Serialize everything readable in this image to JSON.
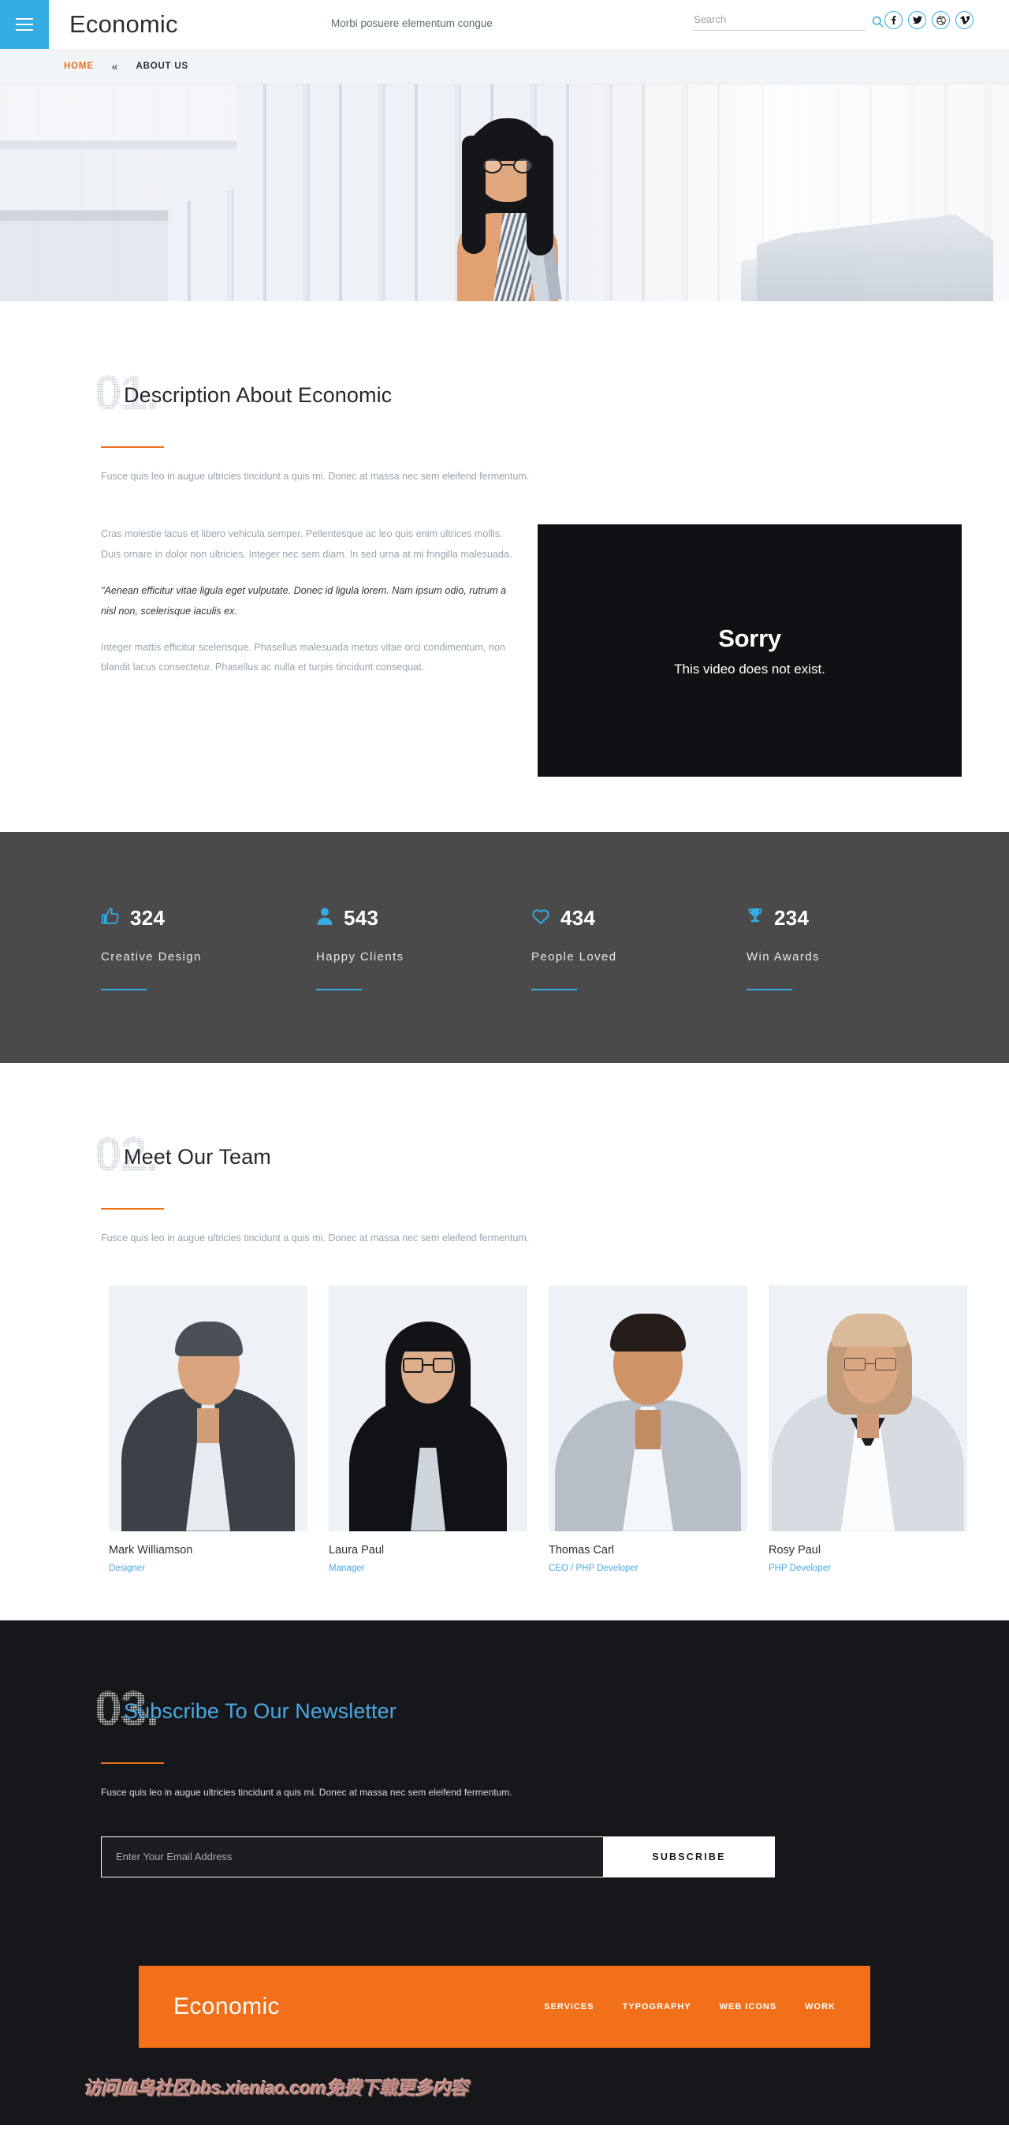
{
  "header": {
    "menu_icon": "hamburger-icon",
    "brand": "Economic",
    "tagline": "Morbi posuere elementum congue",
    "search": {
      "placeholder": "Search",
      "value": "",
      "icon": "search-icon"
    },
    "socials": [
      {
        "name": "facebook-icon",
        "glyph": "f"
      },
      {
        "name": "twitter-icon",
        "glyph": "t"
      },
      {
        "name": "dribbble-icon",
        "glyph": "d"
      },
      {
        "name": "vimeo-icon",
        "glyph": "v"
      }
    ]
  },
  "nav": {
    "items": [
      {
        "label": "HOME",
        "active": true
      },
      {
        "label": "ABOUT US",
        "active": false
      }
    ],
    "separator": "«"
  },
  "section01": {
    "number": "01.",
    "title": "Description About Economic",
    "lead": "Fusce quis leo in augue ultricies tincidunt a quis mi. Donec at massa nec sem eleifend fermentum.",
    "paragraphs": [
      "Cras molestie lacus et libero vehicula semper. Pellentesque ac leo quis enim ultrices mollis. Duis ornare in dolor non ultricies. Integer nec sem diam. In sed urna at mi fringilla malesuada.",
      "\"Aenean efficitur vitae ligula eget vulputate. Donec id ligula lorem. Nam ipsum odio, rutrum a nisl non, scelerisque iaculis ex.",
      "Integer mattis efficitur scelerisque. Phasellus malesuada metus vitae orci condimentum, non blandit lacus consectetur. Phasellus ac nulla et turpis tincidunt consequat."
    ],
    "video": {
      "title": "Sorry",
      "message": "This video does not exist."
    }
  },
  "stats": [
    {
      "icon": "thumbs-up-icon",
      "value": "324",
      "label": "Creative Design"
    },
    {
      "icon": "user-icon",
      "value": "543",
      "label": "Happy Clients"
    },
    {
      "icon": "heart-icon",
      "value": "434",
      "label": "People Loved"
    },
    {
      "icon": "trophy-icon",
      "value": "234",
      "label": "Win Awards"
    }
  ],
  "section02": {
    "number": "02.",
    "title": "Meet Our Team",
    "lead": "Fusce quis leo in augue ultricies tincidunt a quis mi. Donec at massa nec sem eleifend fermentum.",
    "members": [
      {
        "name": "Mark Williamson",
        "role": "Designer"
      },
      {
        "name": "Laura Paul",
        "role": "Manager"
      },
      {
        "name": "Thomas Carl",
        "role": "CEO / PHP Developer"
      },
      {
        "name": "Rosy Paul",
        "role": "PHP Developer"
      }
    ]
  },
  "section03": {
    "number": "03.",
    "title": "Subscribe To Our Newsletter",
    "lead": "Fusce quis leo in augue ultricies tincidunt a quis mi. Donec at massa nec sem eleifend fermentum.",
    "email": {
      "placeholder": "Enter Your Email Address",
      "value": ""
    },
    "subscribe_label": "SUBSCRIBE"
  },
  "footer": {
    "brand": "Economic",
    "links": [
      "SERVICES",
      "TYPOGRAPHY",
      "WEB ICONS",
      "WORK"
    ]
  },
  "watermark": "访问血鸟社区bbs.xieniao.com免费下载更多内容",
  "colors": {
    "accent_blue": "#35ace4",
    "accent_orange": "#f0701a",
    "stats_bg": "#4a4a4a",
    "dark_bg": "#15171a"
  }
}
